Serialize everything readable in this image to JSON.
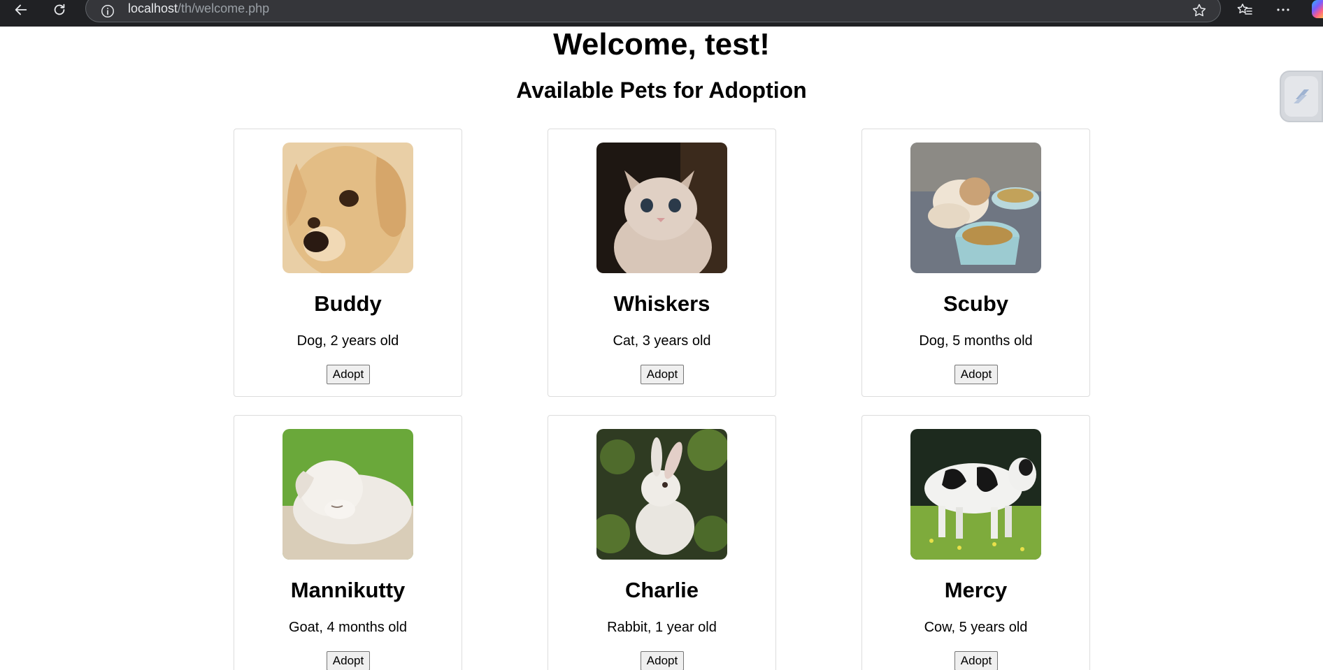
{
  "browser": {
    "url_host": "localhost",
    "url_path": "/th/welcome.php"
  },
  "page": {
    "title": "Welcome, test!",
    "subtitle": "Available Pets for Adoption"
  },
  "pets": [
    {
      "name": "Buddy",
      "info": "Dog, 2 years old",
      "button": "Adopt",
      "photo": "golden-retriever-puppy"
    },
    {
      "name": "Whiskers",
      "info": "Cat, 3 years old",
      "button": "Adopt",
      "photo": "white-kitten"
    },
    {
      "name": "Scuby",
      "info": "Dog, 5 months old",
      "button": "Adopt",
      "photo": "shih-tzu-puppy-with-bowls"
    },
    {
      "name": "Mannikutty",
      "info": "Goat, 4 months old",
      "button": "Adopt",
      "photo": "sleeping-white-goat-kid"
    },
    {
      "name": "Charlie",
      "info": "Rabbit, 1 year old",
      "button": "Adopt",
      "photo": "white-rabbit-in-grass"
    },
    {
      "name": "Mercy",
      "info": "Cow, 5 years old",
      "button": "Adopt",
      "photo": "holstein-cow-in-field"
    }
  ]
}
